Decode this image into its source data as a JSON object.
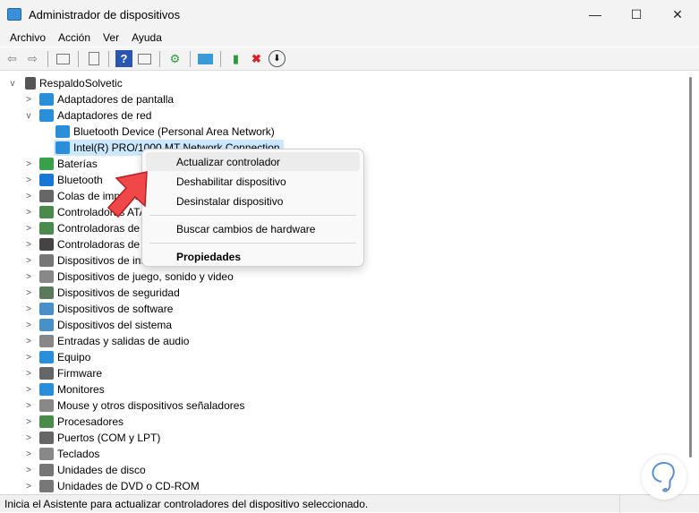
{
  "window": {
    "title": "Administrador de dispositivos",
    "minimize": "—",
    "maximize": "☐",
    "close": "✕"
  },
  "menu": [
    "Archivo",
    "Acción",
    "Ver",
    "Ayuda"
  ],
  "toolbar": {
    "back": "⇦",
    "forward": "⇨",
    "help": "?",
    "uninstall": "✖",
    "download": "⬇"
  },
  "tree": {
    "root": "RespaldoSolvetic",
    "items": [
      {
        "label": "Adaptadores de pantalla",
        "exp": ">",
        "color": "#2a8fd8"
      },
      {
        "label": "Adaptadores de red",
        "exp": "v",
        "color": "#2a8fd8"
      },
      {
        "label": "Bluetooth Device (Personal Area Network)",
        "child": true,
        "color": "#2a8fd8"
      },
      {
        "label": "Intel(R) PRO/1000 MT Network Connection",
        "child": true,
        "selected": true,
        "color": "#2a8fd8"
      },
      {
        "label": "Baterías",
        "exp": ">",
        "color": "#3aa04a"
      },
      {
        "label": "Bluetooth",
        "exp": ">",
        "color": "#1976d2"
      },
      {
        "label": "Colas de impresió",
        "exp": ">",
        "color": "#666"
      },
      {
        "label": "Controladoras ATA",
        "exp": ">",
        "color": "#4a8a4a"
      },
      {
        "label": "Controladoras de",
        "exp": ">",
        "color": "#4a8a4a"
      },
      {
        "label": "Controladoras de",
        "exp": ">",
        "color": "#444"
      },
      {
        "label": "Dispositivos de int",
        "exp": ">",
        "color": "#777"
      },
      {
        "label": "Dispositivos de juego, sonido y video",
        "exp": ">",
        "color": "#888"
      },
      {
        "label": "Dispositivos de seguridad",
        "exp": ">",
        "color": "#5a7a5a"
      },
      {
        "label": "Dispositivos de software",
        "exp": ">",
        "color": "#4a90c8"
      },
      {
        "label": "Dispositivos del sistema",
        "exp": ">",
        "color": "#4a90c8"
      },
      {
        "label": "Entradas y salidas de audio",
        "exp": ">",
        "color": "#888"
      },
      {
        "label": "Equipo",
        "exp": ">",
        "color": "#2a8fd8"
      },
      {
        "label": "Firmware",
        "exp": ">",
        "color": "#666"
      },
      {
        "label": "Monitores",
        "exp": ">",
        "color": "#2a8fd8"
      },
      {
        "label": "Mouse y otros dispositivos señaladores",
        "exp": ">",
        "color": "#888"
      },
      {
        "label": "Procesadores",
        "exp": ">",
        "color": "#4a8a4a"
      },
      {
        "label": "Puertos (COM y LPT)",
        "exp": ">",
        "color": "#666"
      },
      {
        "label": "Teclados",
        "exp": ">",
        "color": "#888"
      },
      {
        "label": "Unidades de disco",
        "exp": ">",
        "color": "#777"
      },
      {
        "label": "Unidades de DVD o CD-ROM",
        "exp": ">",
        "color": "#777"
      }
    ]
  },
  "context_menu": {
    "update": "Actualizar controlador",
    "disable": "Deshabilitar dispositivo",
    "uninstall": "Desinstalar dispositivo",
    "scan": "Buscar cambios de hardware",
    "properties": "Propiedades"
  },
  "status": "Inicia el Asistente para actualizar controladores del dispositivo seleccionado."
}
